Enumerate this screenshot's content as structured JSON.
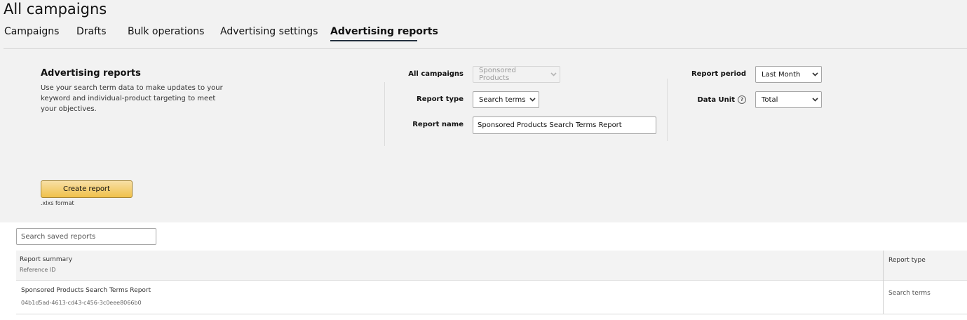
{
  "header": {
    "title": "All campaigns",
    "tabs": [
      {
        "label": "Campaigns",
        "active": false
      },
      {
        "label": "Drafts",
        "active": false
      },
      {
        "label": "Bulk operations",
        "active": false
      },
      {
        "label": "Advertising settings",
        "active": false
      },
      {
        "label": "Advertising reports",
        "active": true
      }
    ]
  },
  "reports_form": {
    "title": "Advertising reports",
    "description": "Use your search term data to make updates to your keyword and individual-product targeting to meet your objectives.",
    "all_campaigns_label": "All campaigns",
    "all_campaigns_value": "Sponsored Products",
    "report_type_label": "Report type",
    "report_type_value": "Search terms",
    "report_name_label": "Report name",
    "report_name_value": "Sponsored Products Search Terms Report",
    "report_period_label": "Report period",
    "report_period_value": "Last Month",
    "data_unit_label": "Data Unit",
    "data_unit_value": "Total",
    "help_icon": "question-circle-icon",
    "create_button_label": "Create report",
    "format_note": ".xlxs format"
  },
  "saved_reports": {
    "search_placeholder": "Search saved reports",
    "columns": {
      "summary": "Report summary",
      "summary_sub": "Reference ID",
      "type": "Report type"
    },
    "rows": [
      {
        "name": "Sponsored Products Search Terms Report",
        "reference_id": "04b1d5ad-4613-cd43-c456-3c0eee8066b0",
        "type": "Search terms"
      }
    ]
  },
  "colors": {
    "button_bg": "#f0c14b",
    "button_border": "#a88734",
    "tab_underline": "#232f3e",
    "panel_bg": "#f2f2f2"
  }
}
